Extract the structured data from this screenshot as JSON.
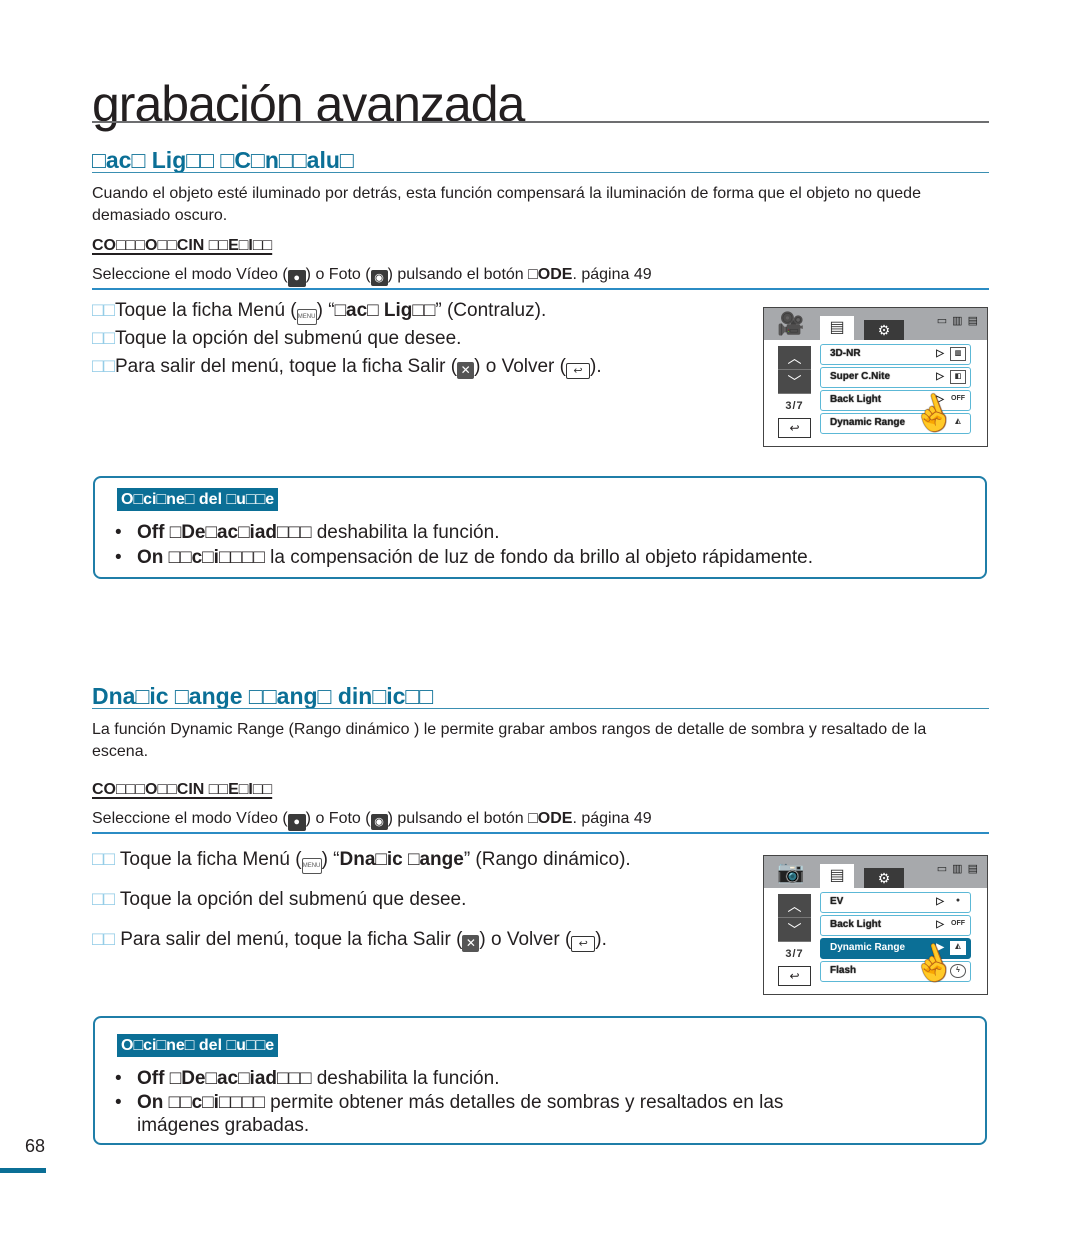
{
  "page": {
    "title": "grabación avanzada",
    "page_number": "68"
  },
  "sections": [
    {
      "heading": "□ac□ Lig□□ □C□n□□alu□",
      "description": "Cuando el objeto esté iluminado por detrás, esta función compensará la iluminación de forma que el objeto no quede demasiado oscuro.",
      "prereq_label": "CO□□□O□□CIN □□E□I□□",
      "prereq": {
        "text_before": "Seleccione el modo Vídeo (",
        "video_icon": "video-mode-icon",
        "text_mid": ") o Foto (",
        "photo_icon": "photo-mode-icon",
        "text_after": ") pulsando el botón ",
        "button_name": "□ODE",
        "ref": ".    página 49"
      },
      "steps": [
        {
          "num": "□□",
          "text_a": "Toque la ficha Menú (",
          "icon": "menu-icon",
          "text_b": ")    “",
          "bold": "□ac□ Lig□□",
          "text_c": "” (Contraluz)."
        },
        {
          "num": "□□",
          "text_a": "Toque la opción del submenú que desee."
        },
        {
          "num": "□□",
          "text_a": "Para salir del menú, toque la ficha Salir (",
          "icon": "exit-icon",
          "text_b": ") o Volver (",
          "icon2": "back-icon",
          "text_c": ")."
        }
      ],
      "screen": {
        "mode_icon": "video-camera-icon",
        "status": "▭ ▥ ▤",
        "page_indicator": "3/7",
        "items": [
          {
            "label": "3D-NR",
            "arrow": "▷",
            "icon": "3dnr-value-icon",
            "active": false
          },
          {
            "label": "Super C.Nite",
            "arrow": "▷",
            "icon": "super-cnite-value-icon",
            "active": false
          },
          {
            "label": "Back Light",
            "arrow": "▷",
            "icon": "backlight-off-icon",
            "active": false
          },
          {
            "label": "Dynamic Range",
            "arrow": "▷",
            "icon": "dynamic-range-icon",
            "active": false
          }
        ]
      },
      "options": {
        "label": "O□ci□ne□ del □u□□e",
        "items": [
          {
            "term": "Off □De□ac□iad□□□",
            "desc": " deshabilita la función."
          },
          {
            "term": "On □□c□i□□□□",
            "desc": " la compensación de luz de fondo da brillo al objeto rápidamente."
          }
        ]
      }
    },
    {
      "heading": "Dna□ic □ange □□ang□ din□ic□□",
      "description": "La función Dynamic Range (Rango dinámico ) le permite grabar ambos rangos de detalle de sombra y resaltado de la escena.",
      "prereq_label": "CO□□□O□□CIN □□E□I□□",
      "prereq": {
        "text_before": "Seleccione el modo Vídeo (",
        "video_icon": "video-mode-icon",
        "text_mid": ") o Foto (",
        "photo_icon": "photo-mode-icon",
        "text_after": ") pulsando el botón ",
        "button_name": "□ODE",
        "ref": ".    página 49"
      },
      "steps": [
        {
          "num": "□□",
          "text_a": " Toque la ficha Menú (",
          "icon": "menu-icon",
          "text_b": ")    “",
          "bold": "Dna□ic □ange",
          "text_c": "” (Rango dinámico)."
        },
        {
          "num": "□□",
          "text_a": " Toque la opción del submenú que desee."
        },
        {
          "num": "□□",
          "text_a": " Para salir del menú, toque la ficha Salir (",
          "icon": "exit-icon",
          "text_b": ") o Volver (",
          "icon2": "back-icon",
          "text_c": ")."
        }
      ],
      "screen": {
        "mode_icon": "photo-camera-icon",
        "status": "▭ ▥ ▤",
        "page_indicator": "3/7",
        "items": [
          {
            "label": "EV",
            "arrow": "▷",
            "icon": "ev-value-icon",
            "active": false
          },
          {
            "label": "Back Light",
            "arrow": "▷",
            "icon": "backlight-off-icon",
            "active": false
          },
          {
            "label": "Dynamic Range",
            "arrow": "▶",
            "icon": "dynamic-range-icon",
            "active": true
          },
          {
            "label": "Flash",
            "arrow": "",
            "icon": "flash-icon",
            "active": false
          }
        ]
      },
      "options": {
        "label": "O□ci□ne□ del □u□□e",
        "items": [
          {
            "term": "Off □De□ac□iad□□□",
            "desc": " deshabilita la función."
          },
          {
            "term": "On □□c□i□□□□",
            "desc": " permite obtener más detalles de sombras y resaltados en las",
            "desc2": "imágenes grabadas."
          }
        ]
      }
    }
  ],
  "colors": {
    "accent": "#0b6f96",
    "rule": "#2b8cc4",
    "text": "#231f20"
  }
}
